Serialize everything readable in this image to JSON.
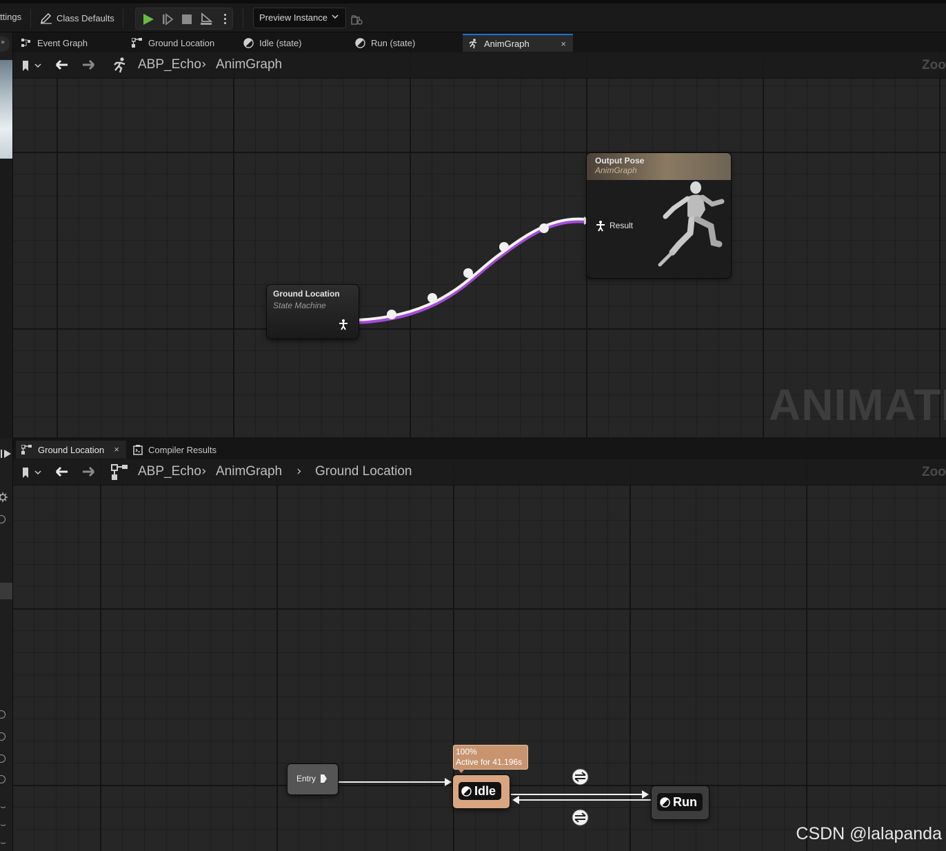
{
  "toolbar": {
    "settings_label": "ttings",
    "class_defaults_label": "Class Defaults",
    "preview_instance_label": "Preview Instance"
  },
  "tabs_top": [
    {
      "label": "Event Graph",
      "icon": "event-graph-icon"
    },
    {
      "label": "Ground Location",
      "icon": "state-machine-icon"
    },
    {
      "label": "Idle (state)",
      "icon": "state-icon"
    },
    {
      "label": "Run (state)",
      "icon": "state-icon"
    },
    {
      "label": "AnimGraph",
      "icon": "running-figure-icon",
      "active": true,
      "close": "×"
    }
  ],
  "top_graph": {
    "breadcrumb": [
      "ABP_Echo",
      "AnimGraph"
    ],
    "zoom_label": "Zoo",
    "watermark": "ANIMATIO",
    "output_node": {
      "title": "Output Pose",
      "subtitle": "AnimGraph",
      "pin_label": "Result"
    },
    "state_machine_node": {
      "title": "Ground Location",
      "subtitle": "State Machine"
    }
  },
  "tabs_bottom": [
    {
      "label": "Ground Location",
      "icon": "state-machine-icon",
      "close": "×"
    },
    {
      "label": "Compiler Results",
      "icon": "compiler-results-icon"
    }
  ],
  "bottom_graph": {
    "breadcrumb": [
      "ABP_Echo",
      "AnimGraph",
      "Ground Location"
    ],
    "zoom_label": "Zoo",
    "entry_label": "Entry",
    "idle_state": {
      "label": "Idle",
      "weight": "100%",
      "active_time": "Active for 41.196s"
    },
    "run_state": {
      "label": "Run"
    }
  },
  "watermark_credit": "CSDN @lalapanda",
  "colors": {
    "accent_tab": "#1f6fd1",
    "wire_purple": "#a64bd8",
    "idle_active": "#d9a581",
    "play_green": "#6abb3f"
  }
}
